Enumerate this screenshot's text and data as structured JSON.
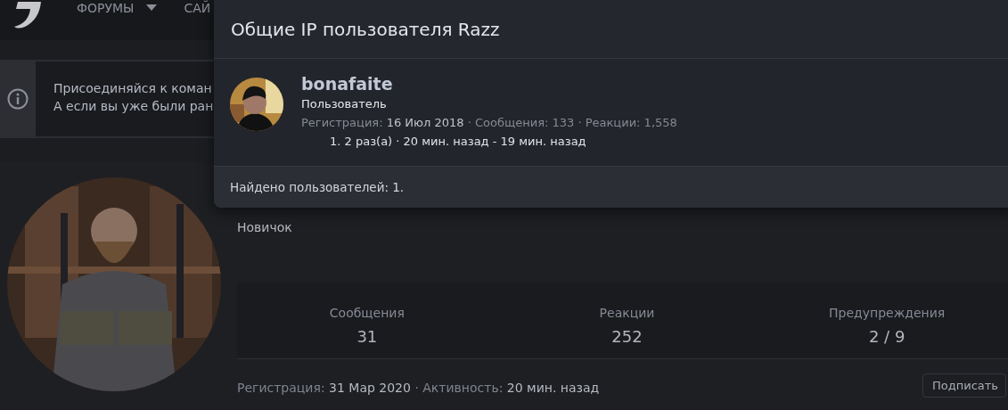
{
  "nav": {
    "items": [
      {
        "label": "ФОРУМЫ",
        "has_menu": true
      },
      {
        "label": "САЙ",
        "has_menu": false
      }
    ]
  },
  "notice": {
    "lines": [
      "Присоединяйся к коман",
      "А если вы уже были ран"
    ]
  },
  "profile": {
    "avatar": {
      "kind": "picture"
    },
    "title": "Новичок",
    "stats": [
      {
        "label": "Сообщения",
        "value": "31"
      },
      {
        "label": "Реакции",
        "value": "252"
      },
      {
        "label": "Предупреждения",
        "value": "2 / 9"
      }
    ],
    "info": "Регистрация: **31 Мар 2020** · Активность: **20 мин. назад**",
    "follow_button": "Подписать"
  },
  "modal": {
    "title": "Общие IP пользователя Razz",
    "users": [
      {
        "avatar": {
          "kind": "picture"
        },
        "name": "bonafaite",
        "role": "Пользователь",
        "meta": "Регистрация: **16 Июл 2018** · Сообщения: 133 · Реакции: 1,558",
        "ips": [
          "1. 2 раз(а) · 20 мин. назад - 19 мин. назад"
        ]
      }
    ],
    "footer": "Найдено пользователей: 1."
  }
}
